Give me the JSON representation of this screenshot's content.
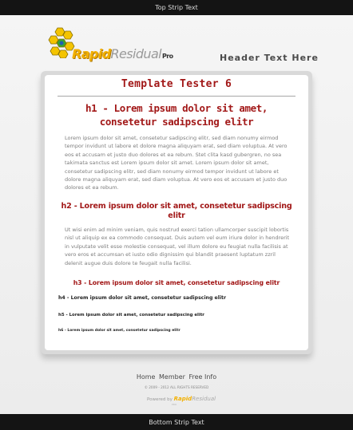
{
  "top_strip": {
    "text": "Top Strip Text"
  },
  "logo": {
    "brand_rapid": "Rapid",
    "brand_residual": "Residual",
    "brand_pro": "Pro"
  },
  "header": {
    "text": "Header Text Here"
  },
  "content": {
    "site_title": "Template Tester 6",
    "h1": "h1 - Lorem ipsum dolor sit amet, consetetur sadipscing elitr",
    "paragraph1": "Lorem ipsum dolor sit amet, consetetur sadipscing elitr, sed diam nonumy eirmod tempor invidunt ut labore et dolore magna aliquyam erat, sed diam voluptua. At vero eos et accusam et justo duo dolores et ea rebum. Stet clita kasd gubergren, no sea takimata sanctus est Lorem ipsum dolor sit amet. Lorem ipsum dolor sit amet, consetetur sadipscing elitr, sed diam nonumy eirmod tempor invidunt ut labore et dolore magna aliquyam erat, sed diam voluptua. At vero eos et accusam et justo duo dolores et ea rebum.",
    "h2": "h2 - Lorem ipsum dolor sit amet, consetetur sadipscing elitr",
    "paragraph2": "Ut wisi enim ad minim veniam, quis nostrud exerci tation ullamcorper suscipit lobortis nisl ut aliquip ex ea commodo consequat. Duis autem vel eum iriure dolor in hendrerit in vulputate velit esse molestie consequat, vel illum dolore eu feugiat nulla facilisis at vero eros et accumsan et iusto odio dignissim qui blandit praesent luptatum zzril delenit augue duis dolore te feugait nulla facilisi.",
    "h3": "h3 - Lorem ipsum dolor sit amet, consetetur sadipscing elitr",
    "h4": "h4 - Lorem ipsum dolor sit amet, consetetur sadipscing elitr",
    "h5": "h5 - Lorem ipsum dolor sit amet, consetetur sadipscing elitr",
    "h6": "h6 - Lorem ipsum dolor sit amet, consetetur sadipscing elitr"
  },
  "footer": {
    "nav": [
      "Home",
      "Member",
      "Free Info"
    ],
    "copyright": "© 2009 - 2012 ALL RIGHTS RESERVED",
    "powered_label": "Powered by",
    "powered_brand_rapid": "Rapid",
    "powered_brand_residual": "Residual",
    "powered_brand_sub": "PRO"
  },
  "bottom_strip": {
    "text": "Bottom Strip Text"
  },
  "colors": {
    "accent": "#a21818",
    "brand_yellow": "#f2b000",
    "strip": "#141414"
  }
}
